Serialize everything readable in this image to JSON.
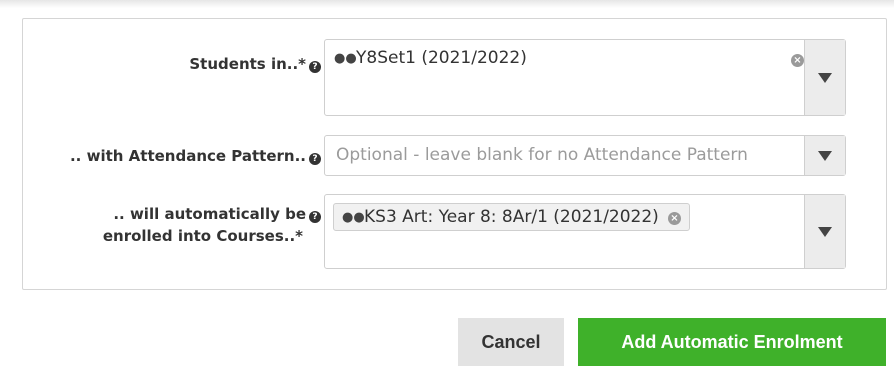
{
  "form": {
    "students_label": "Students in..*",
    "attendance_label": ".. with Attendance Pattern..",
    "courses_label_line1": ".. will automatically be",
    "courses_label_line2": "enrolled into Courses..*",
    "students_value": "Y8Set1 (2021/2022)",
    "attendance_placeholder": "Optional - leave blank for no Attendance Pattern",
    "course_chip": "KS3 Art: Year 8: 8Ar/1 (2021/2022)"
  },
  "icons": {
    "help": "question-circle-icon",
    "group": "users-icon",
    "clear": "times-circle-icon",
    "dropdown": "caret-down-icon"
  },
  "buttons": {
    "cancel": "Cancel",
    "add": "Add Automatic Enrolment"
  },
  "colors": {
    "primary": "#3fb12a",
    "secondary": "#e3e3e3"
  }
}
